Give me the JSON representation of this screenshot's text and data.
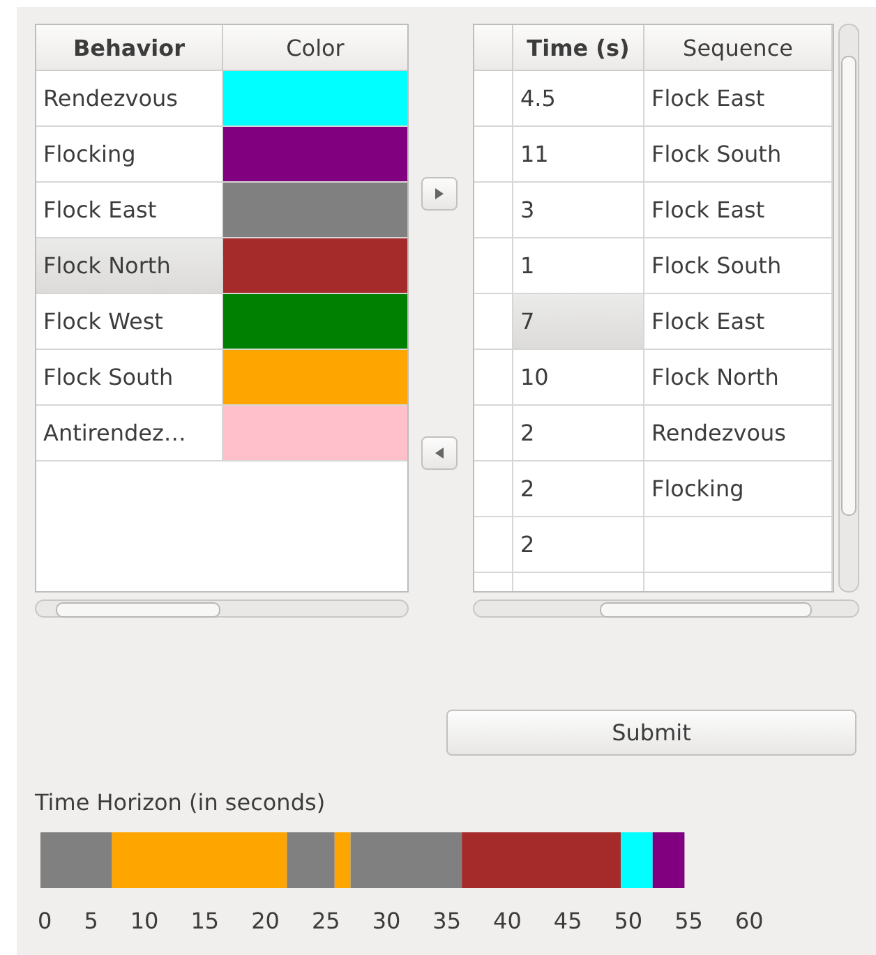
{
  "behaviors": {
    "columns": [
      "Behavior",
      "Color"
    ],
    "rows": [
      {
        "name": "Rendezvous",
        "color": "#00ffff",
        "selected": false
      },
      {
        "name": "Flocking",
        "color": "#800080",
        "selected": false
      },
      {
        "name": "Flock East",
        "color": "#808080",
        "selected": false
      },
      {
        "name": "Flock North",
        "color": "#a52a2a",
        "selected": true
      },
      {
        "name": "Flock West",
        "color": "#008000",
        "selected": false
      },
      {
        "name": "Flock South",
        "color": "#ffa500",
        "selected": false
      },
      {
        "name": "Antirendez…",
        "color": "#ffc0cb",
        "selected": false
      }
    ]
  },
  "sequence": {
    "columns": [
      "Time (s)",
      "Sequence"
    ],
    "rows": [
      {
        "time": "4.5",
        "behavior": "Flock East",
        "selected": false
      },
      {
        "time": "11",
        "behavior": "Flock South",
        "selected": false
      },
      {
        "time": "3",
        "behavior": "Flock East",
        "selected": false
      },
      {
        "time": "1",
        "behavior": "Flock South",
        "selected": false
      },
      {
        "time": "7",
        "behavior": "Flock East",
        "selected": true
      },
      {
        "time": "10",
        "behavior": "Flock North",
        "selected": false
      },
      {
        "time": "2",
        "behavior": "Rendezvous",
        "selected": false
      },
      {
        "time": "2",
        "behavior": "Flocking",
        "selected": false
      },
      {
        "time": "2",
        "selected": false
      }
    ]
  },
  "submit_button": "Submit",
  "time_horizon": {
    "label": "Time Horizon (in seconds)",
    "segments": [
      {
        "color": "#808080"
      },
      {
        "color": "#ffa500"
      },
      {
        "color": "#808080"
      },
      {
        "color": "#ffa500"
      },
      {
        "color": "#808080"
      },
      {
        "color": "#a52a2a"
      },
      {
        "color": "#00ffff"
      },
      {
        "color": "#800080"
      }
    ],
    "axis_labels": [
      "0",
      "5",
      "10",
      "15",
      "20",
      "25",
      "30",
      "35",
      "40",
      "45",
      "50",
      "55",
      "60"
    ]
  }
}
